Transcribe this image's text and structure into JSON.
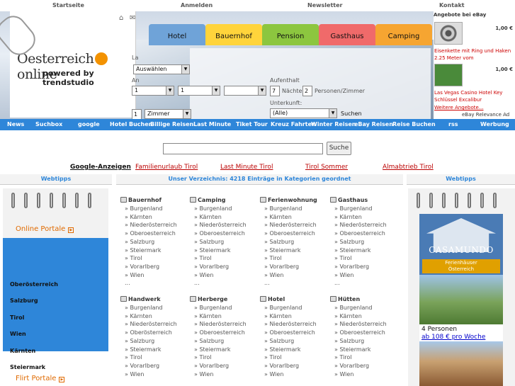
{
  "top_links": [
    "Startseite",
    "Anmelden",
    "Newsletter",
    "Kontakt"
  ],
  "logo": {
    "name_left": "Oesterreich",
    "name_right": "online",
    "powered": "powered by trendstudio"
  },
  "tabs": [
    "Hotel",
    "Bauernhof",
    "Pension",
    "Gasthaus",
    "Camping"
  ],
  "form": {
    "region_value": "Auswählen",
    "adults_value": "1",
    "kids_value": "1",
    "aufenthalt_label": "Aufenthalt",
    "naechte_value": "7",
    "naechte_label": "Nächte",
    "personen_value": "2",
    "personen_label": "Personen/Zimmer",
    "unterkunft_label": "Unterkunft:",
    "unterkunft_value": "(Alle)",
    "zimmer_count": "1",
    "zimmer_value": "Zimmer",
    "suchen_label": "Suchen",
    "lbl_a": "La",
    "lbl_b": "An"
  },
  "ebay": {
    "title": "Angebote bei eBay",
    "items": [
      {
        "price": "1,00 €",
        "text": "Eisenkette mit Ring und Haken 2.25 Meter vom"
      },
      {
        "price": "1,00 €",
        "text": "Las Vegas Casino Hotel Key Schlüssel Excalibur"
      }
    ],
    "more": "Weitere Angebote...",
    "relevance": "eBay Relevance Ad"
  },
  "nav": [
    "News",
    "Suchbox",
    "google",
    "Hotel Buchen",
    "Billige Reisen",
    "Last Minute",
    "Tiket Tour",
    "Kreuz Fahrten",
    "Winter Reisen",
    "eBay Reisen",
    "Reise Buchen",
    "rss",
    "Werbung"
  ],
  "search": {
    "button": "Suche",
    "value": ""
  },
  "ads": {
    "label": "Google-Anzeigen",
    "links": [
      "Familienurlaub Tirol",
      "Last Minute Tirol",
      "Tirol Sommer",
      "Almabtrieb Tirol"
    ]
  },
  "left_head": "Webtipps",
  "center_head": "Unser Verzeichnis: 4218 Einträge in Kategorien geordnet",
  "right_head": "Webtipps",
  "left_links": {
    "portale": "Online Portale",
    "items": [
      "Oberösterreich",
      "Salzburg",
      "Tirol",
      "Wien",
      "Kärnten",
      "Steiermark"
    ],
    "flirt": "Flirt Portale"
  },
  "categories": [
    {
      "title": "Bauernhof",
      "items": [
        "Burgenland",
        "Kärnten",
        "Niederösterreich",
        "Oberoesterreich",
        "Salzburg",
        "Steiermark",
        "Tirol",
        "Vorarlberg",
        "Wien",
        "..."
      ]
    },
    {
      "title": "Camping",
      "items": [
        "Burgenland",
        "Kärnten",
        "Niederösterreich",
        "Oberoesterreich",
        "Salzburg",
        "Steiermark",
        "Tirol",
        "Vorarlberg",
        "Wien",
        "..."
      ]
    },
    {
      "title": "Ferienwohnung",
      "items": [
        "Burgenland",
        "Kärnten",
        "Niederösterreich",
        "Oberoesterreich",
        "Salzburg",
        "Steiermark",
        "Tirol",
        "Vorarlberg",
        "Wien",
        "..."
      ]
    },
    {
      "title": "Gasthaus",
      "items": [
        "Burgenland",
        "Kärnten",
        "Niederösterreich",
        "Oberoesterreich",
        "Salzburg",
        "Steiermark",
        "Tirol",
        "Vorarlberg",
        "Wien",
        "..."
      ]
    },
    {
      "title": "Handwerk",
      "items": [
        "Burgenland",
        "Kärnten",
        "Niederösterreich",
        "Oberösterreich",
        "Salzburg",
        "Steiermark",
        "Tirol",
        "Vorarlberg",
        "Wien"
      ]
    },
    {
      "title": "Herberge",
      "items": [
        "Burgenland",
        "Kärnten",
        "Niederösterreich",
        "Oberoesterreich",
        "Salzburg",
        "Steiermark",
        "Tirol",
        "Vorarlberg",
        "Wien"
      ]
    },
    {
      "title": "Hotel",
      "items": [
        "Burgenland",
        "Kärnten",
        "Niederösterreich",
        "Oberoesterreich",
        "Salzburg",
        "Steiermark",
        "Tirol",
        "Vorarlberg",
        "Wien"
      ]
    },
    {
      "title": "Hütten",
      "items": [
        "Burgenland",
        "Kärnten",
        "Niederösterreich",
        "Oberoesterreich",
        "Salzburg",
        "Steiermark",
        "Tirol",
        "Vorarlberg",
        "Wien"
      ]
    }
  ],
  "casamundo": {
    "title": "CASAMUNDO",
    "sub_1": "Ferienhäuser",
    "sub_2": "Österreich",
    "persons": "4 Personen",
    "price": "ab 108 € pro Woche"
  }
}
